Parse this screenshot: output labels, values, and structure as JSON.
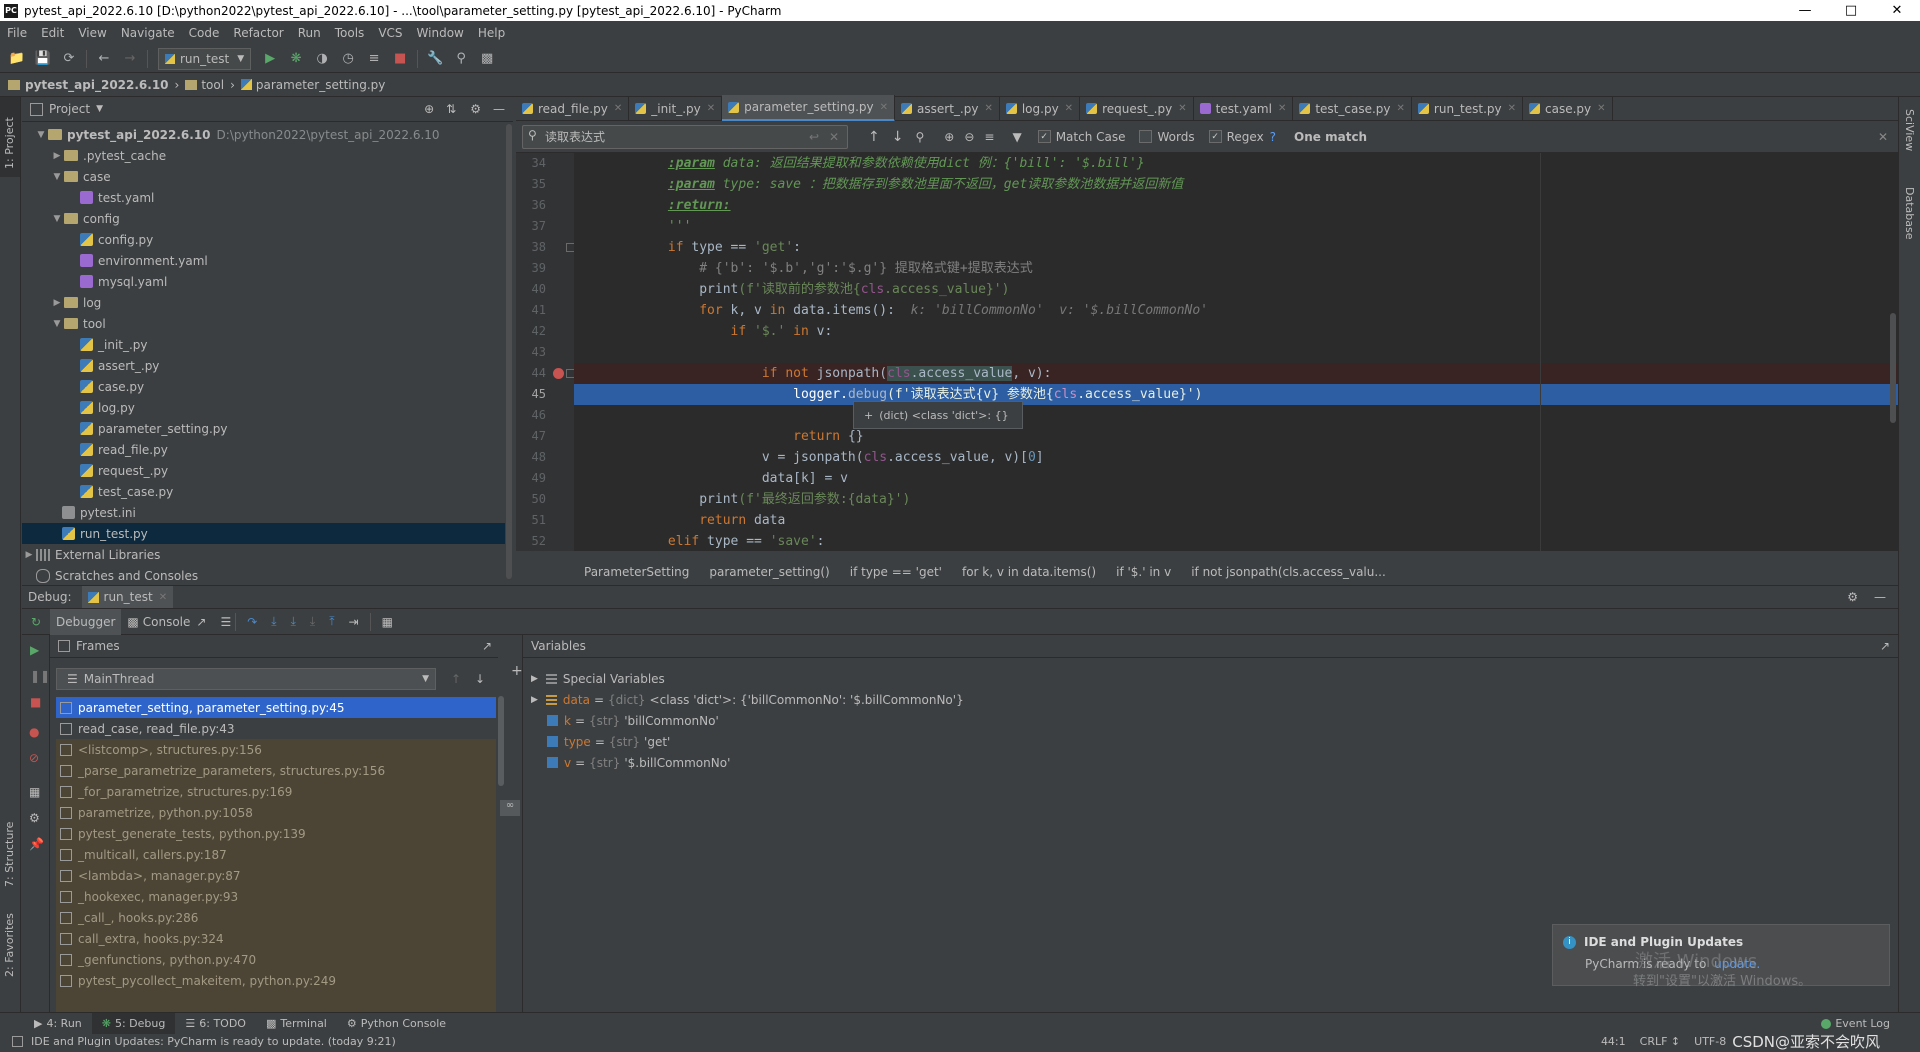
{
  "window": {
    "title": "pytest_api_2022.6.10 [D:\\python2022\\pytest_api_2022.6.10] - ...\\tool\\parameter_setting.py [pytest_api_2022.6.10] - PyCharm",
    "app_icon": "PC"
  },
  "menu": [
    "File",
    "Edit",
    "View",
    "Navigate",
    "Code",
    "Refactor",
    "Run",
    "Tools",
    "VCS",
    "Window",
    "Help"
  ],
  "toolbar": {
    "run_config": "run_test"
  },
  "breadcrumb": {
    "project": "pytest_api_2022.6.10",
    "folder": "tool",
    "file": "parameter_setting.py"
  },
  "left_strip": {
    "project": "1: Project",
    "structure": "7: Structure",
    "favorites": "2: Favorites"
  },
  "right_strip": {
    "sciview": "SciView",
    "database": "Database"
  },
  "project_panel": {
    "title": "Project",
    "root_name": "pytest_api_2022.6.10",
    "root_path": "D:\\python2022\\pytest_api_2022.6.10",
    "items": [
      {
        "label": ".pytest_cache"
      },
      {
        "label": "case"
      },
      {
        "label": "test.yaml"
      },
      {
        "label": "config"
      },
      {
        "label": "config.py"
      },
      {
        "label": "environment.yaml"
      },
      {
        "label": "mysql.yaml"
      },
      {
        "label": "log"
      },
      {
        "label": "tool"
      },
      {
        "label": "_init_.py"
      },
      {
        "label": "assert_.py"
      },
      {
        "label": "case.py"
      },
      {
        "label": "log.py"
      },
      {
        "label": "parameter_setting.py"
      },
      {
        "label": "read_file.py"
      },
      {
        "label": "request_.py"
      },
      {
        "label": "test_case.py"
      },
      {
        "label": "pytest.ini"
      },
      {
        "label": "run_test.py"
      },
      {
        "label": "External Libraries"
      },
      {
        "label": "Scratches and Consoles"
      }
    ]
  },
  "editor_tabs": [
    {
      "label": "read_file.py"
    },
    {
      "label": "_init_.py"
    },
    {
      "label": "parameter_setting.py"
    },
    {
      "label": "assert_.py"
    },
    {
      "label": "log.py"
    },
    {
      "label": "request_.py"
    },
    {
      "label": "test.yaml"
    },
    {
      "label": "test_case.py"
    },
    {
      "label": "run_test.py"
    },
    {
      "label": "case.py"
    }
  ],
  "find_bar": {
    "query": "读取表达式",
    "match_case": "Match Case",
    "words": "Words",
    "regex": "Regex",
    "help": "?",
    "result": "One match"
  },
  "editor": {
    "line_numbers": [
      "34",
      "35",
      "36",
      "37",
      "38",
      "39",
      "40",
      "41",
      "42",
      "43",
      "44",
      "45",
      "46",
      "47",
      "48",
      "49",
      "50",
      "51",
      "52"
    ],
    "l34_a": ":param",
    "l34_b": " data: 返回结果提取和参数依赖使用dict 例：{'bill': '$.bill'}",
    "l35_a": ":param",
    "l35_b": " type: save ：把数据存到参数池里面不返回，get读取参数池数据并返回新值",
    "l36_a": ":return:",
    "l37": "'''",
    "l38_kw": "if",
    "l38_a": " type == ",
    "l38_s": "'get'",
    "l38_c": ":",
    "l39": "# {'b': '$.b','g':'$.g'} 提取格式键+提取表达式",
    "l40_fn": "print",
    "l40_s": "(f'读取前的参数池{",
    "l40_self": "cls",
    "l40_b": ".access_value}')",
    "l41_kw": "for",
    "l41_a": " k, v ",
    "l41_kw2": "in",
    "l41_b": " data.",
    "l41_fn": "items",
    "l41_c": "():  ",
    "l41_hint": "k: 'billCommonNo'  v: '$.billCommonNo'",
    "l42_kw": "if",
    "l42_s": " '$.'",
    "l42_kw2": " in",
    "l42_b": " v:",
    "l44_kw": "if not",
    "l44_a": " jsonpath(",
    "l44_self": "cls",
    "l44_b": ".access_value",
    "l44_c": ", v):",
    "l45_a": "logger.",
    "l45_b": "debug",
    "l45_c": "(f'读取表达式{v} 参数池{",
    "l45_self": "cls",
    "l45_d": ".access_value}')",
    "l47_kw": "return",
    "l47_a": " {}",
    "l48_a": "v = jsonpath(",
    "l48_self": "cls",
    "l48_b": ".access_value, v)[",
    "l48_n": "0",
    "l48_c": "]",
    "l49": "data[k] = v",
    "l50_fn": "print",
    "l50_s": "(f'最终返回参数:{data}')",
    "l51_kw": "return",
    "l51_a": " data",
    "l52_kw": "elif",
    "l52_a": " type == ",
    "l52_s": "'save'",
    "l52_c": ":",
    "tooltip": "(dict) <class 'dict'>: {}"
  },
  "crumbs": [
    "ParameterSetting",
    "parameter_setting()",
    "if type == 'get'",
    "for k, v in data.items()",
    "if '$.' in v",
    "if not jsonpath(cls.access_valu..."
  ],
  "debug": {
    "label": "Debug:",
    "config": "run_test",
    "tab_debugger": "Debugger",
    "tab_console": "Console",
    "frames_title": "Frames",
    "thread": "MainThread",
    "variables_title": "Variables",
    "frames": [
      {
        "label": "parameter_setting, parameter_setting.py:45"
      },
      {
        "label": "read_case, read_file.py:43"
      },
      {
        "label": "<listcomp>, structures.py:156"
      },
      {
        "label": "_parse_parametrize_parameters, structures.py:156"
      },
      {
        "label": "_for_parametrize, structures.py:169"
      },
      {
        "label": "parametrize, python.py:1058"
      },
      {
        "label": "pytest_generate_tests, python.py:139"
      },
      {
        "label": "_multicall, callers.py:187"
      },
      {
        "label": "<lambda>, manager.py:87"
      },
      {
        "label": "_hookexec, manager.py:93"
      },
      {
        "label": "_call_, hooks.py:286"
      },
      {
        "label": "call_extra, hooks.py:324"
      },
      {
        "label": "_genfunctions, python.py:470"
      },
      {
        "label": "pytest_pycollect_makeitem, python.py:249"
      }
    ],
    "variables": [
      {
        "name": "Special Variables",
        "type": "",
        "value": ""
      },
      {
        "name": "data",
        "type": "{dict}",
        "value": "<class 'dict'>: {'billCommonNo': '$.billCommonNo'}"
      },
      {
        "name": "k",
        "type": "{str}",
        "value": "'billCommonNo'"
      },
      {
        "name": "type",
        "type": "{str}",
        "value": "'get'"
      },
      {
        "name": "v",
        "type": "{str}",
        "value": "'$.billCommonNo'"
      }
    ]
  },
  "notification": {
    "title": "IDE and Plugin Updates",
    "body": "PyCharm is ready to",
    "link": "update.",
    "watermark1": "激活 Windows",
    "watermark2": "转到\"设置\"以激活 Windows。"
  },
  "bottom_tabs": [
    {
      "label": "4: Run"
    },
    {
      "label": "5: Debug"
    },
    {
      "label": "6: TODO"
    },
    {
      "label": "Terminal"
    },
    {
      "label": "Python Console"
    },
    {
      "label": "Event Log"
    }
  ],
  "status": {
    "message": "IDE and Plugin Updates: PyCharm is ready to update. (today 9:21)",
    "position": "44:1",
    "line_sep": "CRLF ↕",
    "encoding": "UTF-8",
    "csdn": "CSDN@亚索不会吹风"
  }
}
